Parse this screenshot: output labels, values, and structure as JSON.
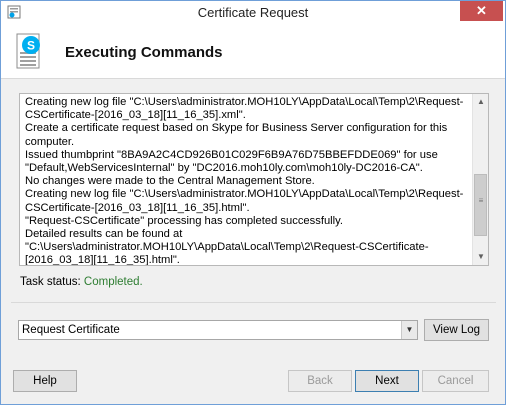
{
  "window": {
    "title": "Certificate Request",
    "close_glyph": "✕"
  },
  "header": {
    "title": "Executing Commands",
    "icon": "skype-document-icon"
  },
  "log": {
    "text": "Creating new log file \"C:\\Users\\administrator.MOH10LY\\AppData\\Local\\Temp\\2\\Request-CSCertificate-[2016_03_18][11_16_35].xml\".\nCreate a certificate request based on Skype for Business Server configuration for this computer.\nIssued thumbprint \"8BA9A2C4CD926B01C029F6B9A76D75BBEFDDE069\" for use \"Default,WebServicesInternal\" by \"DC2016.moh10ly.com\\moh10ly-DC2016-CA\".\nNo changes were made to the Central Management Store.\nCreating new log file \"C:\\Users\\administrator.MOH10LY\\AppData\\Local\\Temp\\2\\Request-CSCertificate-[2016_03_18][11_16_35].html\".\n\"Request-CSCertificate\" processing has completed successfully.\nDetailed results can be found at \"C:\\Users\\administrator.MOH10LY\\AppData\\Local\\Temp\\2\\Request-CSCertificate-[2016_03_18][11_16_35].html\".",
    "scroll_up_glyph": "▲",
    "scroll_down_glyph": "▼"
  },
  "status": {
    "label": "Task status:",
    "value": "Completed.",
    "value_color": "#2e7d32"
  },
  "task_select": {
    "selected": "Request Certificate",
    "arrow_glyph": "▼"
  },
  "buttons": {
    "view_log": "View Log",
    "help": "Help",
    "back": "Back",
    "next": "Next",
    "cancel": "Cancel"
  }
}
